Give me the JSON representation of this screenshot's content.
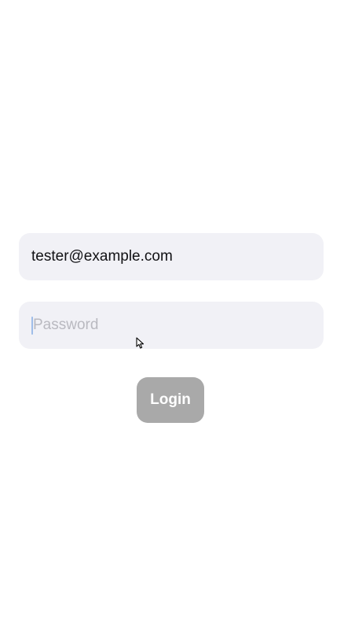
{
  "login": {
    "email_value": "tester@example.com",
    "password_placeholder": "Password",
    "login_label": "Login"
  },
  "colors": {
    "field_background": "#f1f1f6",
    "button_background_disabled": "#a9a9a9",
    "caret": "#9fbde8"
  }
}
